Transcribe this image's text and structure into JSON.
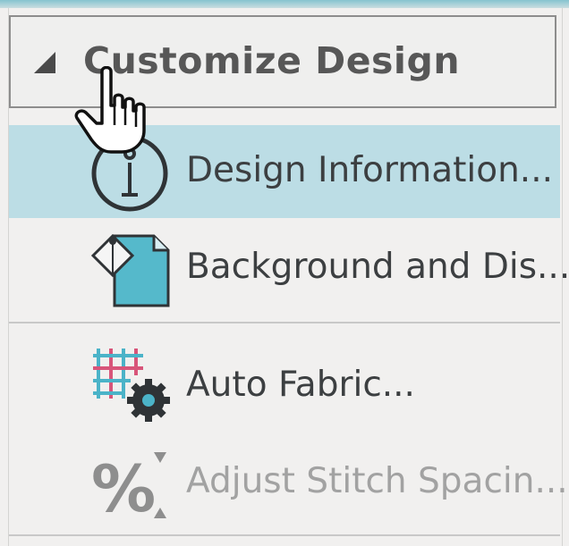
{
  "panel": {
    "title": "Customize Design",
    "items": [
      {
        "label": "Design Information...",
        "icon": "info-icon",
        "selected": true,
        "enabled": true
      },
      {
        "label": "Background and Dis...",
        "icon": "background-icon",
        "selected": false,
        "enabled": true
      },
      {
        "label": "Auto Fabric...",
        "icon": "auto-fabric-icon",
        "selected": false,
        "enabled": true
      },
      {
        "label": "Adjust Stitch Spacin...",
        "icon": "percent-spacing-icon",
        "selected": false,
        "enabled": false
      }
    ]
  },
  "colors": {
    "selection": "#bcdde5",
    "header_border": "#8d8d8d",
    "text": "#3c3f41",
    "disabled_text": "#a2a2a2",
    "icon_teal": "#4bb3c8"
  }
}
